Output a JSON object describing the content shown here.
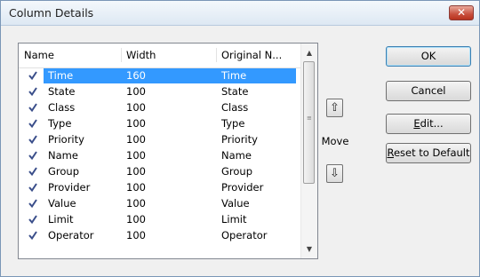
{
  "window": {
    "title": "Column Details",
    "close_glyph": "✕"
  },
  "list": {
    "headers": [
      "Name",
      "Width",
      "Original N..."
    ],
    "rows": [
      {
        "name": "Time",
        "width": "160",
        "original": "Time",
        "checked": true,
        "selected": true
      },
      {
        "name": "State",
        "width": "100",
        "original": "State",
        "checked": true
      },
      {
        "name": "Class",
        "width": "100",
        "original": "Class",
        "checked": true
      },
      {
        "name": "Type",
        "width": "100",
        "original": "Type",
        "checked": true
      },
      {
        "name": "Priority",
        "width": "100",
        "original": "Priority",
        "checked": true
      },
      {
        "name": "Name",
        "width": "100",
        "original": "Name",
        "checked": true
      },
      {
        "name": "Group",
        "width": "100",
        "original": "Group",
        "checked": true
      },
      {
        "name": "Provider",
        "width": "100",
        "original": "Provider",
        "checked": true
      },
      {
        "name": "Value",
        "width": "100",
        "original": "Value",
        "checked": true
      },
      {
        "name": "Limit",
        "width": "100",
        "original": "Limit",
        "checked": true
      },
      {
        "name": "Operator",
        "width": "100",
        "original": "Operator",
        "checked": true
      }
    ]
  },
  "move": {
    "label": "Move",
    "up_icon": "arrow-up-icon",
    "down_icon": "arrow-down-icon"
  },
  "buttons": {
    "ok": "OK",
    "cancel": "Cancel",
    "edit": {
      "pre": "",
      "mnemonic": "E",
      "post": "dit..."
    },
    "reset": {
      "pre": "",
      "mnemonic": "R",
      "post": "eset to Default"
    }
  },
  "colors": {
    "selection": "#3399ff",
    "check": "#3a4e8a"
  }
}
